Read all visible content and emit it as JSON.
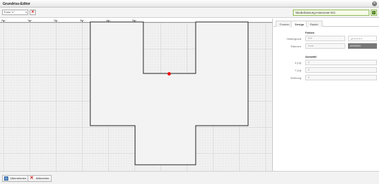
{
  "window": {
    "title": "Grundriss-Editor"
  },
  "toolbar": {
    "shape_select": "Form \"L\"",
    "location": "Niederlassung-Hannover-EG"
  },
  "ruler": {
    "labels": [
      "0m",
      "1m",
      "2m",
      "3m",
      "4m",
      "5m"
    ]
  },
  "panel": {
    "tabs": [
      "Formen",
      "Design",
      "Raster"
    ],
    "active_tab": "Design",
    "colors": {
      "heading": "Farben",
      "background_label": "Hintergrund",
      "background_value": "0%",
      "background_hex": "#FFFFFF",
      "frame_label": "Rahmen",
      "frame_value": "Kein",
      "frame_hex": "#000000"
    },
    "selection": {
      "heading": "Auswahl",
      "x_label": "X [m]",
      "x_value": "0",
      "y_label": "Y [m]",
      "y_value": "0",
      "rotation_label": "Drehung",
      "rotation_value": "0"
    }
  },
  "buttons": {
    "apply": "Übernehmen",
    "cancel": "Abbrechen"
  },
  "colors": {
    "accent_green": "#8fba52",
    "handle_red": "#ee1111"
  }
}
